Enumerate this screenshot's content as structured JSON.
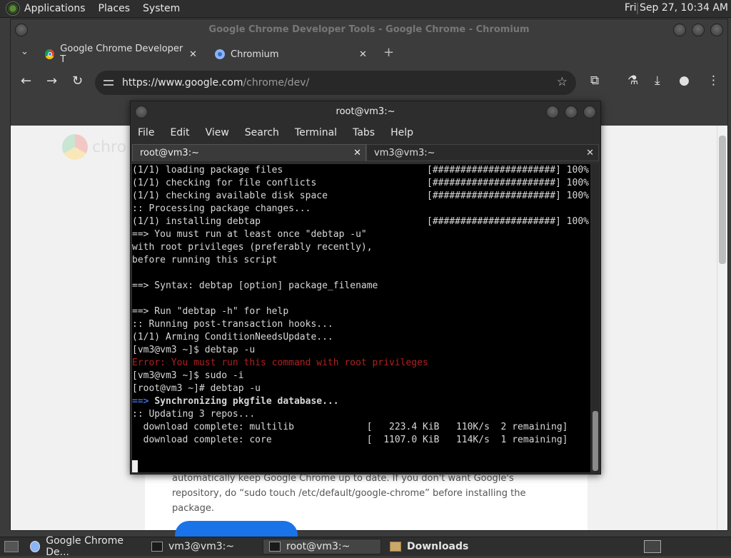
{
  "top_panel": {
    "menu": [
      "Applications",
      "Places",
      "System"
    ],
    "clock": "Fri Sep 27, 10:34 AM"
  },
  "chrome": {
    "window_title": "Google Chrome Developer Tools - Google Chrome - Chromium",
    "tabs": [
      {
        "label": "Google Chrome Developer T",
        "icon": "chrome-favicon-icon"
      },
      {
        "label": "Chromium",
        "icon": "chromium-favicon-icon"
      }
    ],
    "url_host": "https://www.google.com",
    "url_path": "/chrome/dev/",
    "page_logo_text": "chro",
    "page_paragraph": "automatically keep Google Chrome up to date. If you don't want Google's repository, do “sudo touch /etc/default/google-chrome” before installing the package."
  },
  "terminal": {
    "window_title": "root@vm3:~",
    "menu": [
      "File",
      "Edit",
      "View",
      "Search",
      "Terminal",
      "Tabs",
      "Help"
    ],
    "tabs": [
      "root@vm3:~",
      "vm3@vm3:~"
    ],
    "lines": [
      {
        "text": "(1/1) loading package files",
        "progress": "[######################] 100%"
      },
      {
        "text": "(1/1) checking for file conflicts",
        "progress": "[######################] 100%"
      },
      {
        "text": "(1/1) checking available disk space",
        "progress": "[######################] 100%"
      },
      {
        "text": ":: Processing package changes...",
        "progress": ""
      },
      {
        "text": "(1/1) installing debtap",
        "progress": "[######################] 100%"
      },
      {
        "text": "==> You must run at least once \"debtap -u\"",
        "progress": ""
      },
      {
        "text": "with root privileges (preferably recently),",
        "progress": ""
      },
      {
        "text": "before running this script",
        "progress": ""
      },
      {
        "text": "",
        "progress": ""
      },
      {
        "text": "==> Syntax: debtap [option] package_filename",
        "progress": ""
      },
      {
        "text": "",
        "progress": ""
      },
      {
        "text": "==> Run \"debtap -h\" for help",
        "progress": ""
      },
      {
        "text": ":: Running post-transaction hooks...",
        "progress": ""
      },
      {
        "text": "(1/1) Arming ConditionNeedsUpdate...",
        "progress": ""
      },
      {
        "text": "[vm3@vm3 ~]$ debtap -u",
        "progress": ""
      },
      {
        "text": "Error: You must run this command with root privileges",
        "progress": ""
      },
      {
        "text": "[vm3@vm3 ~]$ sudo -i",
        "progress": ""
      },
      {
        "text": "[root@vm3 ~]# debtap -u",
        "progress": ""
      },
      {
        "text": "Synchronizing pkgfile database...",
        "progress": ""
      },
      {
        "text": ":: Updating 3 repos...",
        "progress": ""
      },
      {
        "text": "  download complete: multilib             [   223.4 KiB   110K/s  2 remaining]",
        "progress": ""
      },
      {
        "text": "  download complete: core                 [  1107.0 KiB   114K/s  1 remaining]",
        "progress": ""
      }
    ],
    "arrow": "==>"
  },
  "taskbar": {
    "tasks": [
      "Google Chrome De...",
      "vm3@vm3:~",
      "root@vm3:~",
      "Downloads"
    ]
  },
  "colors": {
    "error_red": "#b02020",
    "arrow_blue": "#3c6fdc",
    "chrome_blue": "#1a73e8"
  }
}
